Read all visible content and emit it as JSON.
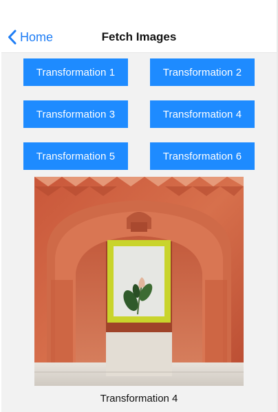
{
  "navbar": {
    "back_label": "Home",
    "title": "Fetch Images"
  },
  "buttons": [
    {
      "label": "Transformation 1"
    },
    {
      "label": "Transformation 2"
    },
    {
      "label": "Transformation 3"
    },
    {
      "label": "Transformation 4"
    },
    {
      "label": "Transformation 5"
    },
    {
      "label": "Transformation 6"
    }
  ],
  "image": {
    "caption": "Transformation 4"
  },
  "colors": {
    "accent": "#1e7df5",
    "button_bg": "#1e8bff",
    "content_bg": "#f2f2f2",
    "frame_border": "#c9d42c"
  },
  "icons": {
    "back": "chevron-left-icon"
  }
}
